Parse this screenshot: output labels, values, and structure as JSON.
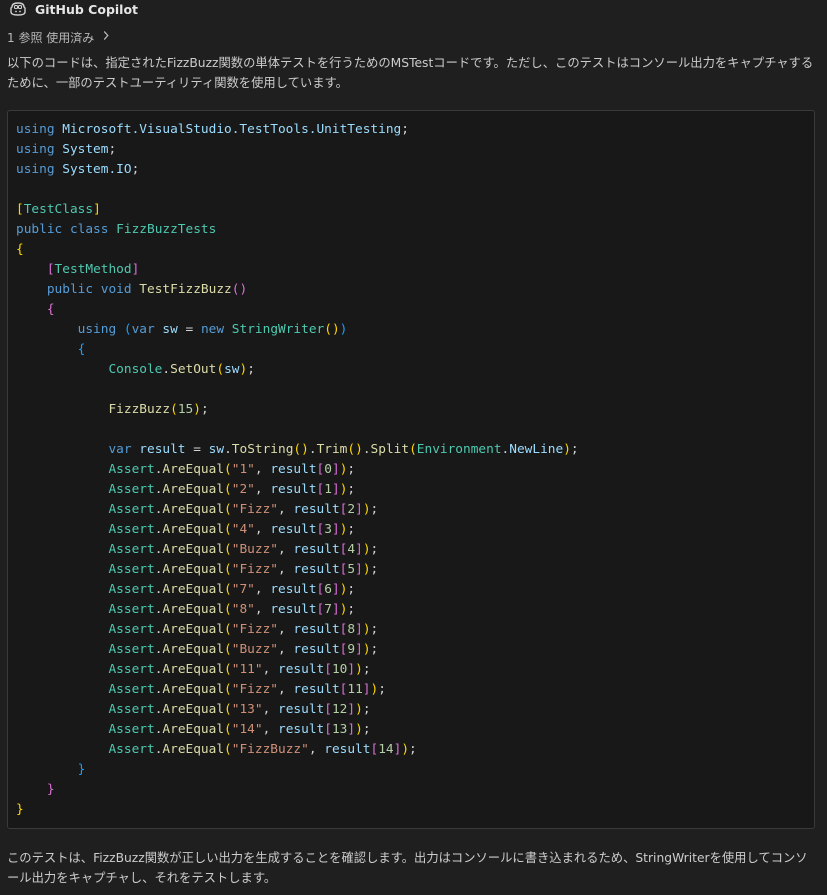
{
  "header": {
    "author": "GitHub Copilot",
    "avatar_icon": "copilot-icon"
  },
  "references": {
    "label": "1 参照 使用済み",
    "icon": "chevron-right-icon"
  },
  "intro_text": "以下のコードは、指定されたFizzBuzz関数の単体テストを行うためのMSTestコードです。ただし、このテストはコンソール出力をキャプチャするために、一部のテストユーティリティ関数を使用しています。",
  "outro_text": "このテストは、FizzBuzz関数が正しい出力を生成することを確認します。出力はコンソールに書き込まれるため、StringWriterを使用してコンソール出力をキャプチャし、それをテストします。",
  "colors": {
    "keyword": "#569cd6",
    "type": "#4ec9b0",
    "method": "#dcdcaa",
    "string": "#ce9178",
    "number": "#b5cea8",
    "variable": "#9cdcfe",
    "plain": "#d4d4d4",
    "bracket1": "#ffd700",
    "bracket2": "#da70d6",
    "bracket3": "#179fff"
  },
  "code_lines": [
    [
      [
        "using ",
        "kw"
      ],
      [
        "Microsoft.VisualStudio.TestTools.UnitTesting",
        "ns"
      ],
      [
        ";",
        "p"
      ]
    ],
    [
      [
        "using ",
        "kw"
      ],
      [
        "System",
        "ns"
      ],
      [
        ";",
        "p"
      ]
    ],
    [
      [
        "using ",
        "kw"
      ],
      [
        "System.IO",
        "ns"
      ],
      [
        ";",
        "p"
      ]
    ],
    [],
    [
      [
        "[",
        "b1"
      ],
      [
        "TestClass",
        "ty"
      ],
      [
        "]",
        "b1"
      ]
    ],
    [
      [
        "public ",
        "kw"
      ],
      [
        "class ",
        "kw"
      ],
      [
        "FizzBuzzTests",
        "ty"
      ]
    ],
    [
      [
        "{",
        "b1"
      ]
    ],
    [
      [
        "    ",
        "p"
      ],
      [
        "[",
        "b2"
      ],
      [
        "TestMethod",
        "ty"
      ],
      [
        "]",
        "b2"
      ]
    ],
    [
      [
        "    ",
        "p"
      ],
      [
        "public ",
        "kw"
      ],
      [
        "void ",
        "kw"
      ],
      [
        "TestFizzBuzz",
        "fn"
      ],
      [
        "()",
        "b2"
      ]
    ],
    [
      [
        "    ",
        "p"
      ],
      [
        "{",
        "b2"
      ]
    ],
    [
      [
        "        ",
        "p"
      ],
      [
        "using ",
        "kw"
      ],
      [
        "(",
        "b3"
      ],
      [
        "var ",
        "kw"
      ],
      [
        "sw ",
        "va"
      ],
      [
        "= ",
        "p"
      ],
      [
        "new ",
        "kw"
      ],
      [
        "StringWriter",
        "ty"
      ],
      [
        "()",
        "b1"
      ],
      [
        ")",
        "b3"
      ]
    ],
    [
      [
        "        ",
        "p"
      ],
      [
        "{",
        "b3"
      ]
    ],
    [
      [
        "            ",
        "p"
      ],
      [
        "Console",
        "ty"
      ],
      [
        ".",
        "p"
      ],
      [
        "SetOut",
        "fn"
      ],
      [
        "(",
        "b1"
      ],
      [
        "sw",
        "va"
      ],
      [
        ")",
        "b1"
      ],
      [
        ";",
        "p"
      ]
    ],
    [],
    [
      [
        "            ",
        "p"
      ],
      [
        "FizzBuzz",
        "fn"
      ],
      [
        "(",
        "b1"
      ],
      [
        "15",
        "nu"
      ],
      [
        ")",
        "b1"
      ],
      [
        ";",
        "p"
      ]
    ],
    [],
    [
      [
        "            ",
        "p"
      ],
      [
        "var ",
        "kw"
      ],
      [
        "result ",
        "va"
      ],
      [
        "= ",
        "p"
      ],
      [
        "sw",
        "va"
      ],
      [
        ".",
        "p"
      ],
      [
        "ToString",
        "fn"
      ],
      [
        "()",
        "b1"
      ],
      [
        ".",
        "p"
      ],
      [
        "Trim",
        "fn"
      ],
      [
        "()",
        "b1"
      ],
      [
        ".",
        "p"
      ],
      [
        "Split",
        "fn"
      ],
      [
        "(",
        "b1"
      ],
      [
        "Environment",
        "ty"
      ],
      [
        ".",
        "p"
      ],
      [
        "NewLine",
        "va"
      ],
      [
        ")",
        "b1"
      ],
      [
        ";",
        "p"
      ]
    ],
    [
      [
        "            ",
        "p"
      ],
      [
        "Assert",
        "ty"
      ],
      [
        ".",
        "p"
      ],
      [
        "AreEqual",
        "fn"
      ],
      [
        "(",
        "b1"
      ],
      [
        "\"1\"",
        "st"
      ],
      [
        ", ",
        "p"
      ],
      [
        "result",
        "va"
      ],
      [
        "[",
        "b2"
      ],
      [
        "0",
        "nu"
      ],
      [
        "]",
        "b2"
      ],
      [
        ")",
        "b1"
      ],
      [
        ";",
        "p"
      ]
    ],
    [
      [
        "            ",
        "p"
      ],
      [
        "Assert",
        "ty"
      ],
      [
        ".",
        "p"
      ],
      [
        "AreEqual",
        "fn"
      ],
      [
        "(",
        "b1"
      ],
      [
        "\"2\"",
        "st"
      ],
      [
        ", ",
        "p"
      ],
      [
        "result",
        "va"
      ],
      [
        "[",
        "b2"
      ],
      [
        "1",
        "nu"
      ],
      [
        "]",
        "b2"
      ],
      [
        ")",
        "b1"
      ],
      [
        ";",
        "p"
      ]
    ],
    [
      [
        "            ",
        "p"
      ],
      [
        "Assert",
        "ty"
      ],
      [
        ".",
        "p"
      ],
      [
        "AreEqual",
        "fn"
      ],
      [
        "(",
        "b1"
      ],
      [
        "\"Fizz\"",
        "st"
      ],
      [
        ", ",
        "p"
      ],
      [
        "result",
        "va"
      ],
      [
        "[",
        "b2"
      ],
      [
        "2",
        "nu"
      ],
      [
        "]",
        "b2"
      ],
      [
        ")",
        "b1"
      ],
      [
        ";",
        "p"
      ]
    ],
    [
      [
        "            ",
        "p"
      ],
      [
        "Assert",
        "ty"
      ],
      [
        ".",
        "p"
      ],
      [
        "AreEqual",
        "fn"
      ],
      [
        "(",
        "b1"
      ],
      [
        "\"4\"",
        "st"
      ],
      [
        ", ",
        "p"
      ],
      [
        "result",
        "va"
      ],
      [
        "[",
        "b2"
      ],
      [
        "3",
        "nu"
      ],
      [
        "]",
        "b2"
      ],
      [
        ")",
        "b1"
      ],
      [
        ";",
        "p"
      ]
    ],
    [
      [
        "            ",
        "p"
      ],
      [
        "Assert",
        "ty"
      ],
      [
        ".",
        "p"
      ],
      [
        "AreEqual",
        "fn"
      ],
      [
        "(",
        "b1"
      ],
      [
        "\"Buzz\"",
        "st"
      ],
      [
        ", ",
        "p"
      ],
      [
        "result",
        "va"
      ],
      [
        "[",
        "b2"
      ],
      [
        "4",
        "nu"
      ],
      [
        "]",
        "b2"
      ],
      [
        ")",
        "b1"
      ],
      [
        ";",
        "p"
      ]
    ],
    [
      [
        "            ",
        "p"
      ],
      [
        "Assert",
        "ty"
      ],
      [
        ".",
        "p"
      ],
      [
        "AreEqual",
        "fn"
      ],
      [
        "(",
        "b1"
      ],
      [
        "\"Fizz\"",
        "st"
      ],
      [
        ", ",
        "p"
      ],
      [
        "result",
        "va"
      ],
      [
        "[",
        "b2"
      ],
      [
        "5",
        "nu"
      ],
      [
        "]",
        "b2"
      ],
      [
        ")",
        "b1"
      ],
      [
        ";",
        "p"
      ]
    ],
    [
      [
        "            ",
        "p"
      ],
      [
        "Assert",
        "ty"
      ],
      [
        ".",
        "p"
      ],
      [
        "AreEqual",
        "fn"
      ],
      [
        "(",
        "b1"
      ],
      [
        "\"7\"",
        "st"
      ],
      [
        ", ",
        "p"
      ],
      [
        "result",
        "va"
      ],
      [
        "[",
        "b2"
      ],
      [
        "6",
        "nu"
      ],
      [
        "]",
        "b2"
      ],
      [
        ")",
        "b1"
      ],
      [
        ";",
        "p"
      ]
    ],
    [
      [
        "            ",
        "p"
      ],
      [
        "Assert",
        "ty"
      ],
      [
        ".",
        "p"
      ],
      [
        "AreEqual",
        "fn"
      ],
      [
        "(",
        "b1"
      ],
      [
        "\"8\"",
        "st"
      ],
      [
        ", ",
        "p"
      ],
      [
        "result",
        "va"
      ],
      [
        "[",
        "b2"
      ],
      [
        "7",
        "nu"
      ],
      [
        "]",
        "b2"
      ],
      [
        ")",
        "b1"
      ],
      [
        ";",
        "p"
      ]
    ],
    [
      [
        "            ",
        "p"
      ],
      [
        "Assert",
        "ty"
      ],
      [
        ".",
        "p"
      ],
      [
        "AreEqual",
        "fn"
      ],
      [
        "(",
        "b1"
      ],
      [
        "\"Fizz\"",
        "st"
      ],
      [
        ", ",
        "p"
      ],
      [
        "result",
        "va"
      ],
      [
        "[",
        "b2"
      ],
      [
        "8",
        "nu"
      ],
      [
        "]",
        "b2"
      ],
      [
        ")",
        "b1"
      ],
      [
        ";",
        "p"
      ]
    ],
    [
      [
        "            ",
        "p"
      ],
      [
        "Assert",
        "ty"
      ],
      [
        ".",
        "p"
      ],
      [
        "AreEqual",
        "fn"
      ],
      [
        "(",
        "b1"
      ],
      [
        "\"Buzz\"",
        "st"
      ],
      [
        ", ",
        "p"
      ],
      [
        "result",
        "va"
      ],
      [
        "[",
        "b2"
      ],
      [
        "9",
        "nu"
      ],
      [
        "]",
        "b2"
      ],
      [
        ")",
        "b1"
      ],
      [
        ";",
        "p"
      ]
    ],
    [
      [
        "            ",
        "p"
      ],
      [
        "Assert",
        "ty"
      ],
      [
        ".",
        "p"
      ],
      [
        "AreEqual",
        "fn"
      ],
      [
        "(",
        "b1"
      ],
      [
        "\"11\"",
        "st"
      ],
      [
        ", ",
        "p"
      ],
      [
        "result",
        "va"
      ],
      [
        "[",
        "b2"
      ],
      [
        "10",
        "nu"
      ],
      [
        "]",
        "b2"
      ],
      [
        ")",
        "b1"
      ],
      [
        ";",
        "p"
      ]
    ],
    [
      [
        "            ",
        "p"
      ],
      [
        "Assert",
        "ty"
      ],
      [
        ".",
        "p"
      ],
      [
        "AreEqual",
        "fn"
      ],
      [
        "(",
        "b1"
      ],
      [
        "\"Fizz\"",
        "st"
      ],
      [
        ", ",
        "p"
      ],
      [
        "result",
        "va"
      ],
      [
        "[",
        "b2"
      ],
      [
        "11",
        "nu"
      ],
      [
        "]",
        "b2"
      ],
      [
        ")",
        "b1"
      ],
      [
        ";",
        "p"
      ]
    ],
    [
      [
        "            ",
        "p"
      ],
      [
        "Assert",
        "ty"
      ],
      [
        ".",
        "p"
      ],
      [
        "AreEqual",
        "fn"
      ],
      [
        "(",
        "b1"
      ],
      [
        "\"13\"",
        "st"
      ],
      [
        ", ",
        "p"
      ],
      [
        "result",
        "va"
      ],
      [
        "[",
        "b2"
      ],
      [
        "12",
        "nu"
      ],
      [
        "]",
        "b2"
      ],
      [
        ")",
        "b1"
      ],
      [
        ";",
        "p"
      ]
    ],
    [
      [
        "            ",
        "p"
      ],
      [
        "Assert",
        "ty"
      ],
      [
        ".",
        "p"
      ],
      [
        "AreEqual",
        "fn"
      ],
      [
        "(",
        "b1"
      ],
      [
        "\"14\"",
        "st"
      ],
      [
        ", ",
        "p"
      ],
      [
        "result",
        "va"
      ],
      [
        "[",
        "b2"
      ],
      [
        "13",
        "nu"
      ],
      [
        "]",
        "b2"
      ],
      [
        ")",
        "b1"
      ],
      [
        ";",
        "p"
      ]
    ],
    [
      [
        "            ",
        "p"
      ],
      [
        "Assert",
        "ty"
      ],
      [
        ".",
        "p"
      ],
      [
        "AreEqual",
        "fn"
      ],
      [
        "(",
        "b1"
      ],
      [
        "\"FizzBuzz\"",
        "st"
      ],
      [
        ", ",
        "p"
      ],
      [
        "result",
        "va"
      ],
      [
        "[",
        "b2"
      ],
      [
        "14",
        "nu"
      ],
      [
        "]",
        "b2"
      ],
      [
        ")",
        "b1"
      ],
      [
        ";",
        "p"
      ]
    ],
    [
      [
        "        ",
        "p"
      ],
      [
        "}",
        "b3"
      ]
    ],
    [
      [
        "    ",
        "p"
      ],
      [
        "}",
        "b2"
      ]
    ],
    [
      [
        "}",
        "b1"
      ]
    ]
  ]
}
